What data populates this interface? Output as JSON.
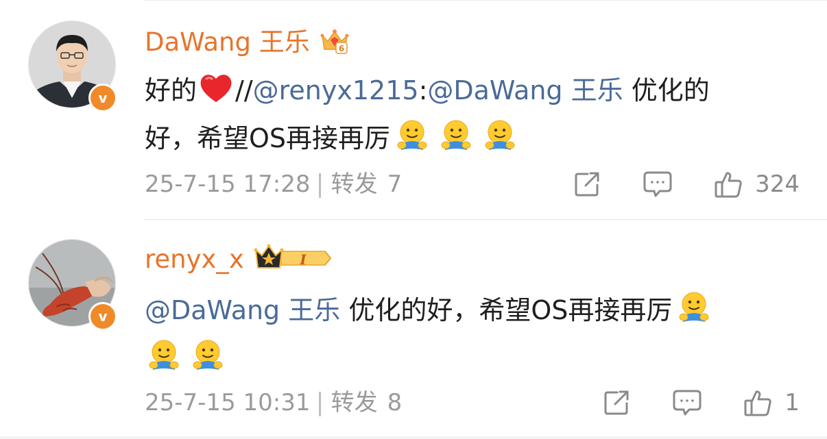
{
  "colors": {
    "username": "#e8742a",
    "mention": "#4a6a98",
    "meta": "#9a9a9a",
    "verified_badge": "#f08a28"
  },
  "posts": [
    {
      "username": "DaWang 王乐",
      "badge_icon": "vip-crown-level-6-icon",
      "verified_icon": "verified-v-icon",
      "lines": [
        {
          "text_before": "好的",
          "emoji_heart": "red-heart-emoji",
          "slashes": "//",
          "mention_1": "@renyx1215",
          "colon": ":",
          "mention_2": "@DaWang 王乐",
          "text_after": " 优化的"
        },
        {
          "text": "好，希望OS再接再厉",
          "emoji": [
            "hug-emoji",
            "hug-emoji",
            "hug-emoji"
          ]
        }
      ],
      "timestamp": "25-7-15 17:28",
      "separator": "|",
      "repost_label": "转发",
      "repost_count": "7",
      "share_icon": "share-icon",
      "comment_icon": "comment-icon",
      "like_icon": "thumbs-up-icon",
      "like_count": "324"
    },
    {
      "username": "renyx_x",
      "badge_icon": "vip-crown-level-1-icon",
      "badge_level": "I",
      "verified_icon": "verified-v-icon",
      "lines": [
        {
          "mention": "@DaWang 王乐",
          "text": " 优化的好，希望OS再接再厉",
          "emoji": [
            "hug-emoji"
          ]
        },
        {
          "emoji": [
            "hug-emoji",
            "hug-emoji"
          ]
        }
      ],
      "timestamp": "25-7-15 10:31",
      "separator": "|",
      "repost_label": "转发",
      "repost_count": "8",
      "share_icon": "share-icon",
      "comment_icon": "comment-icon",
      "like_icon": "thumbs-up-icon",
      "like_count": "1"
    }
  ]
}
